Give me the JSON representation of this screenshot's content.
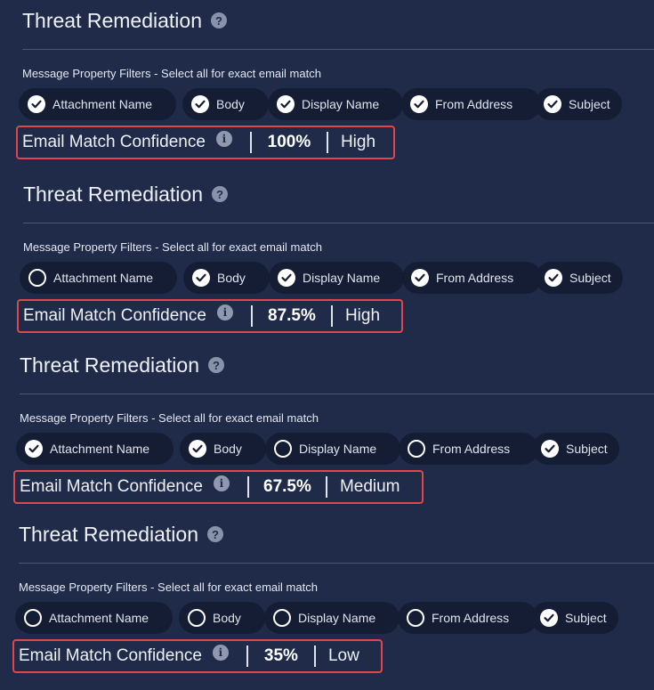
{
  "panels": [
    {
      "title": "Threat Remediation",
      "filters_label": "Message Property Filters - Select all for exact email match",
      "chips": [
        {
          "label": "Attachment Name",
          "checked": true
        },
        {
          "label": "Body",
          "checked": true
        },
        {
          "label": "Display Name",
          "checked": true
        },
        {
          "label": "From Address",
          "checked": true
        },
        {
          "label": "Subject",
          "checked": true
        }
      ],
      "confidence_label": "Email Match Confidence",
      "confidence_value": "100%",
      "confidence_level": "High"
    },
    {
      "title": "Threat Remediation",
      "filters_label": "Message Property Filters - Select all for exact email match",
      "chips": [
        {
          "label": "Attachment Name",
          "checked": false
        },
        {
          "label": "Body",
          "checked": true
        },
        {
          "label": "Display Name",
          "checked": true
        },
        {
          "label": "From Address",
          "checked": true
        },
        {
          "label": "Subject",
          "checked": true
        }
      ],
      "confidence_label": "Email Match Confidence",
      "confidence_value": "87.5%",
      "confidence_level": "High"
    },
    {
      "title": "Threat Remediation",
      "filters_label": "Message Property Filters - Select all for exact email match",
      "chips": [
        {
          "label": "Attachment Name",
          "checked": true
        },
        {
          "label": "Body",
          "checked": true
        },
        {
          "label": "Display Name",
          "checked": false
        },
        {
          "label": "From Address",
          "checked": false
        },
        {
          "label": "Subject",
          "checked": true
        }
      ],
      "confidence_label": "Email Match Confidence",
      "confidence_value": "67.5%",
      "confidence_level": "Medium"
    },
    {
      "title": "Threat Remediation",
      "filters_label": "Message Property Filters - Select all for exact email match",
      "chips": [
        {
          "label": "Attachment Name",
          "checked": false
        },
        {
          "label": "Body",
          "checked": false
        },
        {
          "label": "Display Name",
          "checked": false
        },
        {
          "label": "From Address",
          "checked": false
        },
        {
          "label": "Subject",
          "checked": true
        }
      ],
      "confidence_label": "Email Match Confidence",
      "confidence_value": "35%",
      "confidence_level": "Low"
    }
  ],
  "icons": {
    "help": "question-circle-icon",
    "info": "info-circle-icon",
    "check": "checkmark-circle-icon"
  },
  "colors": {
    "background": "#1f2b49",
    "chip_background": "#141d33",
    "highlight_border": "#e0464c",
    "divider": "#4a5674"
  }
}
